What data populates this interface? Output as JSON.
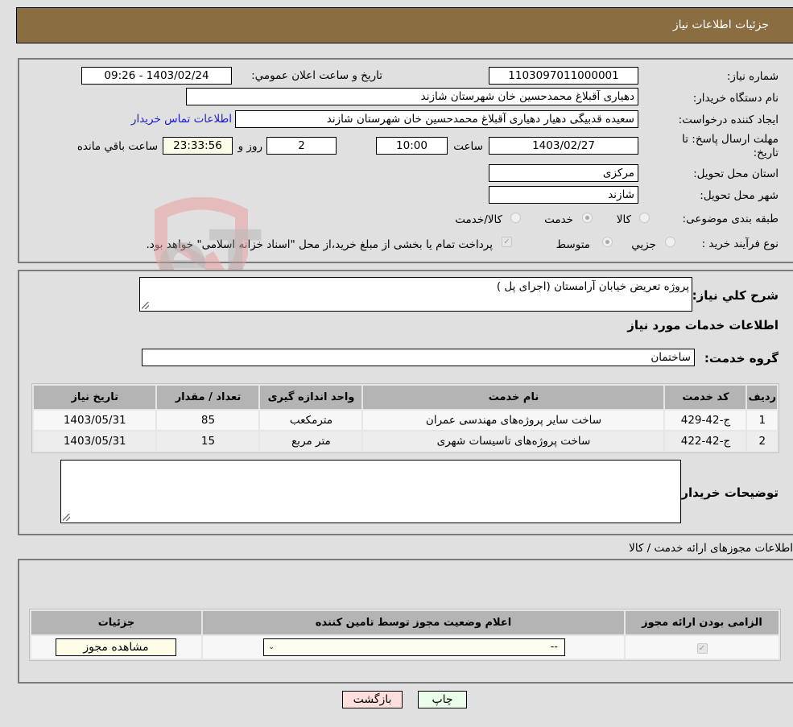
{
  "header": {
    "title": "جزئیات اطلاعات نیاز"
  },
  "form": {
    "need_number": {
      "label": "شماره نیاز:",
      "value": "1103097011000001"
    },
    "announce_datetime": {
      "label": "تاریخ و ساعت اعلان عمومي:",
      "value": "1403/02/24 - 09:26"
    },
    "buyer_org": {
      "label": "نام دستگاه خریدار:",
      "value": "دهیاری آقبلاغ محمدحسین خان شهرستان شازند"
    },
    "requester": {
      "label": "ایجاد کننده درخواست:",
      "value": "سعیده قدبیگی دهیار  دهیاری آقبلاغ محمدحسین خان شهرستان شازند"
    },
    "contact_link": "اطلاعات تماس خریدار",
    "deadline": {
      "label_line1": "مهلت ارسال پاسخ: تا",
      "label_line2": "تاریخ:",
      "date": "1403/02/27",
      "time_label": "ساعت",
      "time": "10:00",
      "days": "2",
      "days_label": "روز و",
      "remaining": "23:33:56",
      "remaining_label": "ساعت باقي مانده"
    },
    "province": {
      "label": "استان محل تحویل:",
      "value": "مرکزی"
    },
    "city": {
      "label": "شهر محل تحویل:",
      "value": "شازند"
    },
    "category": {
      "label": "طبقه بندی موضوعی:",
      "options": [
        "کالا",
        "خدمت",
        "کالا/خدمت"
      ],
      "selected": "خدمت"
    },
    "purchase_type": {
      "label": "نوع فرآیند خرید :",
      "options": [
        "جزيي",
        "متوسط"
      ],
      "selected": "متوسط",
      "treasury_note": "پرداخت تمام یا بخشی از مبلغ خرید،از محل \"اسناد خزانه اسلامی\" خواهد بود.",
      "treasury_checked": true
    }
  },
  "description": {
    "label": "شرح كلي نياز:",
    "value": "پروژه تعریض خیابان آرامستان (اجرای پل )"
  },
  "services": {
    "section_title": "اطلاعات خدمات مورد نیاز",
    "group_label": "گروه خدمت:",
    "group_value": "ساختمان",
    "columns": [
      "ردیف",
      "کد خدمت",
      "نام خدمت",
      "واحد اندازه گیری",
      "تعداد / مقدار",
      "تاریخ نیاز"
    ],
    "rows": [
      {
        "row": "1",
        "code": "ج-42-429",
        "name": "ساخت سایر پروژه‌های مهندسی عمران",
        "unit": "مترمکعب",
        "qty": "85",
        "date": "1403/05/31"
      },
      {
        "row": "2",
        "code": "ج-42-422",
        "name": "ساخت پروژه‌های تاسیسات شهری",
        "unit": "متر مربع",
        "qty": "15",
        "date": "1403/05/31"
      }
    ]
  },
  "buyer_notes": {
    "label": "توضیحات خریدار:",
    "value": ""
  },
  "licenses": {
    "section_title": "اطلاعات مجوزهای ارائه خدمت / کالا",
    "columns": [
      "الزامی بودن ارائه مجوز",
      "اعلام وضعیت مجوز توسط تامین کننده",
      "جزئیات"
    ],
    "row": {
      "required_checked": true,
      "status_value": "--",
      "details_button": "مشاهده مجوز"
    }
  },
  "actions": {
    "print": "چاپ",
    "back": "بازگشت"
  },
  "watermark": "AriaTender.neT",
  "colors": {
    "header": "#8b6d42",
    "link": "#1a1ad6",
    "print_bg": "#eaffea",
    "back_bg": "#ffdede"
  }
}
